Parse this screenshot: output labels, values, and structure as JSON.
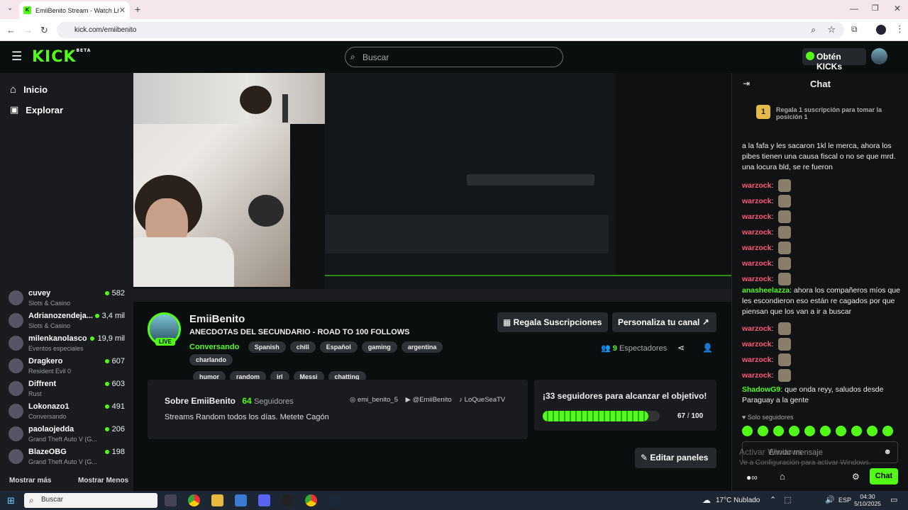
{
  "browser": {
    "tab_title": "EmiiBenito Stream - Watch Live",
    "url": "kick.com/emiibenito"
  },
  "header": {
    "logo": "KICK",
    "logo_badge": "BETA",
    "search_placeholder": "Buscar",
    "kicks_label": "Obtén KICKs"
  },
  "sidebar": {
    "nav": [
      {
        "label": "Inicio",
        "icon": "home-icon"
      },
      {
        "label": "Explorar",
        "icon": "compass-icon"
      }
    ],
    "channels": [
      {
        "name": "cuvey",
        "category": "Slots & Casino",
        "viewers": "582"
      },
      {
        "name": "Adrianozendeja...",
        "category": "Slots & Casino",
        "viewers": "3,4 mil"
      },
      {
        "name": "milenkanolasco",
        "category": "Eventos especiales",
        "viewers": "19,9 mil"
      },
      {
        "name": "Dragkero",
        "category": "Resident Evil 0",
        "viewers": "607"
      },
      {
        "name": "Diffrent",
        "category": "Rust",
        "viewers": "603"
      },
      {
        "name": "Lokonazo1",
        "category": "Conversando",
        "viewers": "491"
      },
      {
        "name": "paolaojedda",
        "category": "Grand Theft Auto V (G...",
        "viewers": "206"
      },
      {
        "name": "BlazeOBG",
        "category": "Grand Theft Auto V (G...",
        "viewers": "198"
      }
    ],
    "show_more": "Mostrar más",
    "show_less": "Mostrar Menos"
  },
  "stream": {
    "channel": "EmiiBenito",
    "title": "ANECDOTAS DEL SECUNDARIO - ROAD TO 100 FOLLOWS",
    "category": "Conversando",
    "live": "LIVE",
    "tags": [
      "Spanish",
      "chill",
      "Español",
      "gaming",
      "argentina",
      "charlando",
      "humor",
      "random",
      "irl",
      "Messi",
      "chatting"
    ],
    "gift_btn": "Regala Suscripciones",
    "customize_btn": "Personaliza tu canal",
    "viewers_count": "9",
    "viewers_label": "Espectadores",
    "about_title": "Sobre EmiiBenito",
    "followers_count": "64",
    "followers_label": "Seguidores",
    "socials": [
      "emi_benito_5",
      "@EmiiBenito",
      "LoQueSeaTV"
    ],
    "bio": "Streams Random todos los días. Metete Cagón",
    "goal_title": "¡33 seguidores para alcanzar el objetivo!",
    "goal_progress": "67",
    "goal_total": "100",
    "goal_fraction": 0.67,
    "edit_panels": "Editar paneles"
  },
  "chat": {
    "title": "Chat",
    "gift_prompt": "Regala 1 suscripción para tomar la posición 1",
    "rank": "1",
    "messages": [
      {
        "user": "",
        "text": "a la fafa y les sacaron 1kl le merca, ahora los pibes tienen una causa fiscal o no se que mrd. una locura bld, se re fueron"
      },
      {
        "user": "warzock",
        "text": ""
      },
      {
        "user": "warzock",
        "text": ""
      },
      {
        "user": "warzock",
        "text": ""
      },
      {
        "user": "warzock",
        "text": ""
      },
      {
        "user": "warzock",
        "text": ""
      },
      {
        "user": "warzock",
        "text": ""
      },
      {
        "user": "warzock",
        "text": ""
      },
      {
        "user": "anasheelazza",
        "text": "ahora los compañeros míos que les escondieron eso están re cagados por que piensan que los van a ir a buscar"
      },
      {
        "user": "warzock",
        "text": ""
      },
      {
        "user": "warzock",
        "text": ""
      },
      {
        "user": "warzock",
        "text": ""
      },
      {
        "user": "warzock",
        "text": ""
      },
      {
        "user": "ShadowG9",
        "text": "que onda reyy, saludos desde Paraguay a la gente"
      }
    ],
    "followers_only": "Solo seguidores",
    "input_placeholder": "Enviar mensaje",
    "send_label": "Chat",
    "watermark1": "Activar Windows",
    "watermark2": "Ve a Configuración para activar Windows."
  },
  "taskbar": {
    "search": "Buscar",
    "weather": "17°C  Nublado",
    "lang": "ESP",
    "time": "04:30",
    "date": "5/10/2025"
  },
  "colors": {
    "accent": "#53fc18",
    "bg": "#0b0e0f",
    "panel": "#191b1f"
  }
}
